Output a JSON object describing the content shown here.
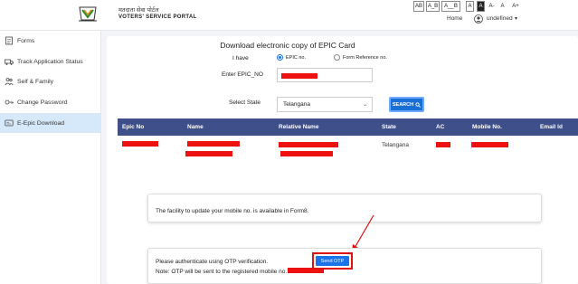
{
  "header": {
    "portal_name_hindi": "मतदाता सेवा पोर्टल",
    "portal_name": "VOTERS' SERVICE PORTAL",
    "accessibility": [
      "AB",
      "A_B",
      "A__B",
      "A",
      "A",
      "A-",
      "A",
      "A+"
    ],
    "home_label": "Home",
    "user_name": "undefined",
    "user_caret": "▾"
  },
  "sidebar": {
    "items": [
      {
        "label": "Forms",
        "icon": "forms-icon"
      },
      {
        "label": "Track Application Status",
        "icon": "truck-icon"
      },
      {
        "label": "Self & Family",
        "icon": "family-icon"
      },
      {
        "label": "Change Password",
        "icon": "key-icon"
      },
      {
        "label": "E-Epic Download",
        "icon": "card-icon",
        "active": true
      }
    ]
  },
  "form": {
    "title": "Download electronic copy of EPIC Card",
    "i_have_label": "I have",
    "radio_options": [
      "EPIC no.",
      "Form Reference no."
    ],
    "selected_radio": 0,
    "epic_no_label": "Enter EPIC_NO",
    "select_state_label": "Select State",
    "state_value": "Telangana",
    "state_caret": "⌄",
    "search_label": "SEARCH",
    "search_icon_glyph": "🔍"
  },
  "table": {
    "headers": [
      "Epic No",
      "Name",
      "Relative Name",
      "State",
      "AC",
      "Mobile No.",
      "Email Id"
    ],
    "row": {
      "state": "Telangana"
    }
  },
  "mobile_notice": {
    "text": "The facility to update your mobile no. is available in Form8."
  },
  "otp_section": {
    "text": "Please authenticate using OTP verification.",
    "button_label": "Send OTP",
    "note": "Note: OTP will be sent to the registered mobile no."
  },
  "colors": {
    "table_header": "#3f4f8a",
    "primary_button": "#1a73e8",
    "redaction": "#ee1111",
    "active_sidebar": "#d6e9fb"
  }
}
